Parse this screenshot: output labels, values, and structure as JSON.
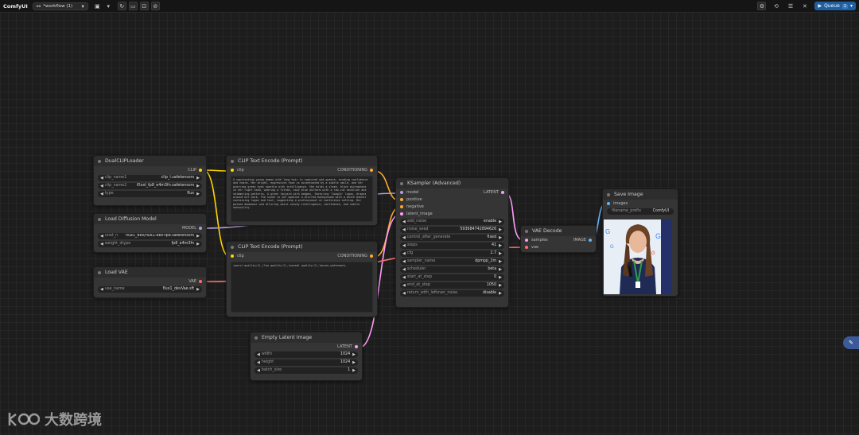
{
  "app": {
    "brand": "ComfyUI",
    "workflow_name": "*workflow (1)"
  },
  "toolbar": {
    "queue_label": "Queue",
    "queue_count": "1"
  },
  "nodes": {
    "dualclip": {
      "title": "DualCLIPLoader",
      "out": "CLIP",
      "widgets": [
        {
          "label": "clip_name1",
          "value": "clip_l.safetensors"
        },
        {
          "label": "clip_name2",
          "value": "t5xxl_fp8_e4m3fn.safetensors"
        },
        {
          "label": "type",
          "value": "flux"
        }
      ]
    },
    "loaddiff": {
      "title": "Load Diffusion Model",
      "out": "MODEL",
      "widgets": [
        {
          "label": "unet_n",
          "value": "flux1_dev/flux1-dev-fp8.safetensors"
        },
        {
          "label": "weight_dtype",
          "value": "fp8_e4m3fn"
        }
      ]
    },
    "loadvae": {
      "title": "Load VAE",
      "out": "VAE",
      "widgets": [
        {
          "label": "vae_name",
          "value": "flux1_devVae.sft"
        }
      ]
    },
    "clip1": {
      "title": "CLIP Text Encode (Prompt)",
      "in": "clip",
      "out": "CONDITIONING",
      "text": "A captivating young woman with long hair is captured mid-speech, exuding confidence and charm. Her bright, expressive face is accentuated by a subtle smile, and her piercing green eyes sparkle with intelligence. She holds a sleek, black microphone in her right hand, wearing a fitted, navy blue uniform with a low-cut neckline and shimmering patterns. A green lanyard with badges, featuring 'Google' logos, drapes around her neck. The scene is set against a blurred background with a white banner containing logos and text, suggesting a professional or conference setting. Her poised demeanor and alluring smile convey intelligence, confidence, and subtle sensuality."
    },
    "clip2": {
      "title": "CLIP Text Encode (Prompt)",
      "in": "clip",
      "out": "CONDITIONING",
      "text": "(worst quality:2),(low quality:2),(normal quality:2),lowres,watermark,"
    },
    "latent": {
      "title": "Empty Latent Image",
      "out": "LATENT",
      "widgets": [
        {
          "label": "width",
          "value": "1024"
        },
        {
          "label": "height",
          "value": "1024"
        },
        {
          "label": "batch_size",
          "value": "1"
        }
      ]
    },
    "ksampler": {
      "title": "KSampler (Advanced)",
      "inputs": [
        "model",
        "positive",
        "negative",
        "latent_image"
      ],
      "out": "LATENT",
      "widgets": [
        {
          "label": "add_noise",
          "value": "enable"
        },
        {
          "label": "noise_seed",
          "value": "593684742894626"
        },
        {
          "label": "control_after_generate",
          "value": "fixed"
        },
        {
          "label": "steps",
          "value": "41"
        },
        {
          "label": "cfg",
          "value": "2.7"
        },
        {
          "label": "sampler_name",
          "value": "dpmpp_2m"
        },
        {
          "label": "scheduler",
          "value": "beta"
        },
        {
          "label": "start_at_step",
          "value": "0"
        },
        {
          "label": "end_at_step",
          "value": "1050"
        },
        {
          "label": "return_with_leftover_noise",
          "value": "disable"
        }
      ]
    },
    "vaedecode": {
      "title": "VAE Decode",
      "inputs": [
        "samples",
        "vae"
      ],
      "out": "IMAGE"
    },
    "saveimage": {
      "title": "Save Image",
      "in": "images",
      "widgets": [
        {
          "label": "filename_prefix",
          "value": "ComfyUI"
        }
      ]
    }
  },
  "watermark": {
    "text": "大数跨境"
  },
  "colors": {
    "clip": "#ffd500",
    "conditioning": "#ffa931",
    "model": "#b39ddb",
    "vae": "#ff6e6e",
    "latent": "#ff9cf9",
    "image": "#64b5f6"
  }
}
